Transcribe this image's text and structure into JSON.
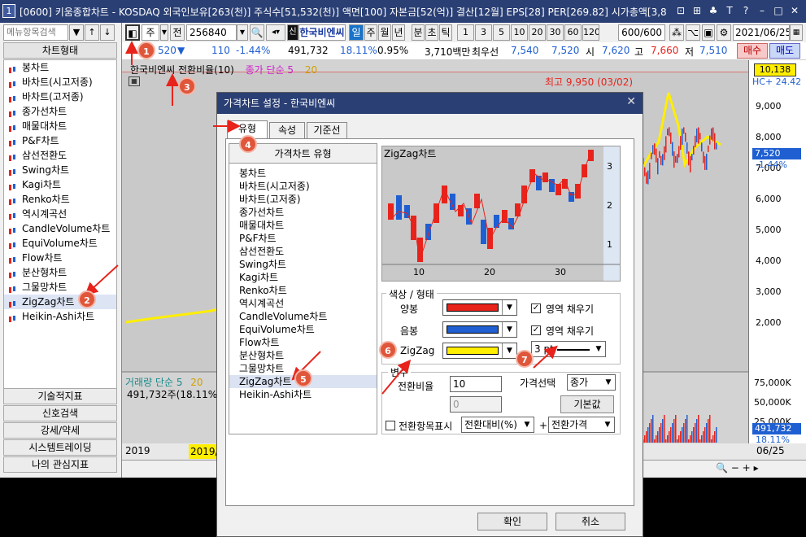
{
  "window": {
    "number": "1",
    "title": "[0600] 키움종합차트 - KOSDAQ 외국인보유[263(천)] 주식수[51,532(천)] 액면[100] 자본금[52(억)] 결산[12월] EPS[28] PER[269.82] 시가총액[3,8"
  },
  "left": {
    "search_placeholder": "메뉴항목검색",
    "section_title": "차트형태",
    "chart_types": [
      "봉차트",
      "바차트(시고저종)",
      "바차트(고저종)",
      "종가선차트",
      "매물대차트",
      "P&F차트",
      "삼선전환도",
      "Swing차트",
      "Kagi차트",
      "Renko차트",
      "역시계곡선",
      "CandleVolume차트",
      "EquiVolume차트",
      "Flow차트",
      "분산형차트",
      "그물망차트",
      "ZigZag차트",
      "Heikin-Ashi차트"
    ],
    "bottom_sections": [
      "기술적지표",
      "신호검색",
      "강세/약세",
      "시스템트레이딩",
      "나의 관심지표"
    ]
  },
  "toolbar": {
    "period_select": "주",
    "full_button": "전",
    "code": "256840",
    "stock_name": "한국비엔씨",
    "day_button": "일",
    "week_button": "주",
    "month_button": "월",
    "year_button": "년",
    "minute_button": "분",
    "second_button": "초",
    "tick_button": "틱",
    "intervals": [
      "1",
      "3",
      "5",
      "10",
      "20",
      "30",
      "60",
      "120"
    ],
    "count": "600/600",
    "date": "2021/06/25"
  },
  "quote": {
    "price": "520",
    "change": "110",
    "change_pct": "-1.44%",
    "volume": "491,732",
    "turnover": "18.11%",
    "ratio": "0.95%",
    "amount": "3,710백만",
    "priority_label": "최우선",
    "bid1": "7,540",
    "bid2": "7,520",
    "open_label": "시",
    "open": "7,620",
    "high_label": "고",
    "high": "7,660",
    "low_label": "저",
    "low": "7,510",
    "buy_button": "매수",
    "sell_button": "매도"
  },
  "chart": {
    "legend": "한국비엔씨 전환비율(10)",
    "legend2": "종가 단순 5",
    "legend2_num": "20",
    "high_annotation": "최고 9,950 (03/02)",
    "volume_legend": "거래량 단순 5",
    "volume_legend_num": "20",
    "volume_value": "491,732주(18.11%)",
    "year1": "2019",
    "year2": "2019/",
    "price_ticks": [
      "9,000",
      "8,000",
      "7,000",
      "6,000",
      "5,000",
      "4,000",
      "3,000",
      "2,000"
    ],
    "current_price_box": "10,138",
    "current_price": "7,520",
    "current_change": "-1.44%",
    "hc_label": "HC+ 24.42",
    "volume_ticks": [
      "75,000K",
      "50,000K",
      "25,000K"
    ],
    "volume_current": "491,732",
    "volume_pct": "18.11%",
    "last_date": "06/25"
  },
  "dialog": {
    "title": "가격차트 설정 - 한국비엔씨",
    "tabs": [
      "유형",
      "속성",
      "기준선"
    ],
    "list_header": "가격차트 유형",
    "types": [
      "봉차트",
      "바차트(시고저종)",
      "바차트(고저종)",
      "종가선차트",
      "매물대차트",
      "P&F차트",
      "삼선전환도",
      "Swing차트",
      "Kagi차트",
      "Renko차트",
      "역시계곡선",
      "CandleVolume차트",
      "EquiVolume차트",
      "Flow차트",
      "분산형차트",
      "그물망차트",
      "ZigZag차트",
      "Heikin-Ashi차트"
    ],
    "selected_type": "ZigZag차트",
    "preview_title": "ZigZag차트",
    "preview_x_ticks": [
      "10",
      "20",
      "30"
    ],
    "preview_y_ticks": [
      "3",
      "2",
      "1"
    ],
    "color_group": "색상 / 형태",
    "up_label": "양봉",
    "down_label": "음봉",
    "zigzag_label": "ZigZag",
    "fill_label_1": "영역 채우기",
    "fill_label_2": "영역 채우기",
    "thickness": "3 pt",
    "var_group": "변수",
    "ratio_label": "전환비율",
    "ratio_value": "10",
    "ratio_value2": "0",
    "price_select_label": "가격선택",
    "price_select_value": "종가",
    "default_button": "기본값",
    "show_label": "전환항목표시",
    "show_select1": "전환대비(%)",
    "plus": "+",
    "show_select2": "전환가격",
    "ok_button": "확인",
    "cancel_button": "취소"
  },
  "annotations": [
    "1",
    "2",
    "3",
    "4",
    "5",
    "6",
    "7"
  ],
  "colors": {
    "up": "#e8231b",
    "down": "#1f5fd1",
    "zigzag": "#ffee00",
    "title_bar": "#2a3f74",
    "annotation": "#e0563a"
  }
}
